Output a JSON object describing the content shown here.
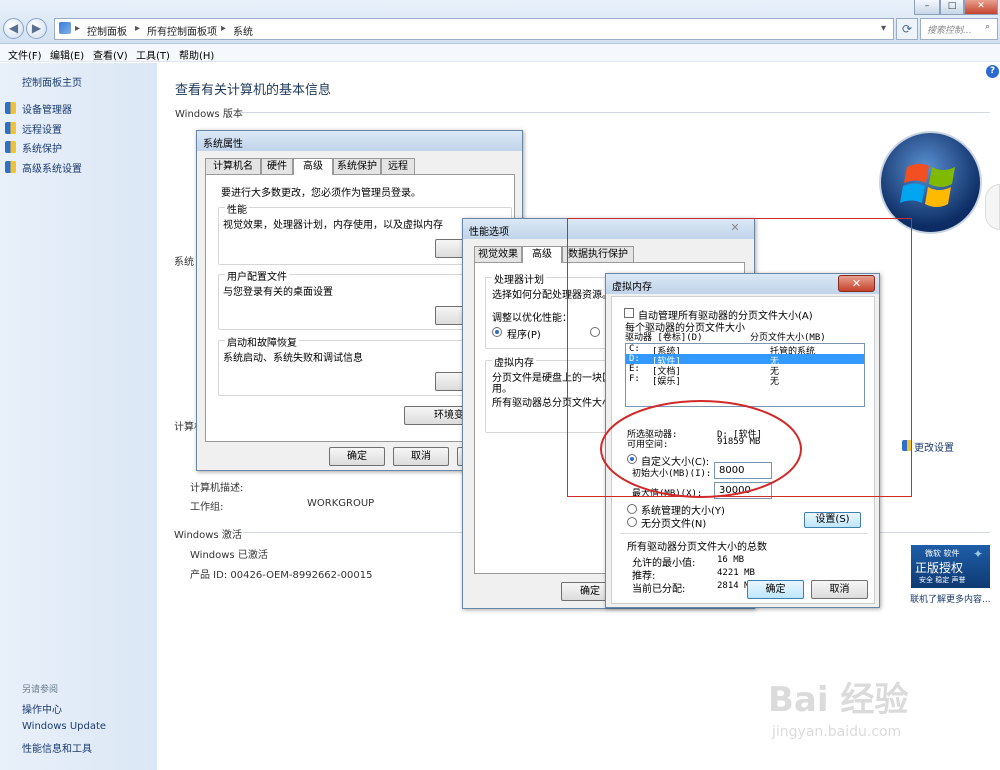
{
  "breadcrumb": [
    "控制面板",
    "所有控制面板项",
    "系统"
  ],
  "search_placeholder": "搜索控制...",
  "window_controls": {
    "minimize": "–",
    "maximize": "□",
    "close": "✕"
  },
  "menu": [
    "文件(F)",
    "编辑(E)",
    "查看(V)",
    "工具(T)",
    "帮助(H)"
  ],
  "left_pane": {
    "home": "控制面板主页",
    "tasks": [
      "设备管理器",
      "远程设置",
      "系统保护",
      "高级系统设置"
    ],
    "see_also_header": "另请参阅",
    "see_also": [
      "操作中心",
      "Windows Update",
      "性能信息和工具"
    ]
  },
  "main": {
    "title": "查看有关计算机的基本信息",
    "windows_edition": "Windows 版本",
    "system": "系统",
    "computer_section": "计算机",
    "computer_description_label": "计算机描述:",
    "workgroup_label": "工作组:",
    "workgroup_value": "WORKGROUP",
    "change_settings": "更改设置",
    "activation_header": "Windows 激活",
    "activation_status": "Windows 已激活",
    "product_id": "产品 ID: 00426-OEM-8992662-00015",
    "genuine": {
      "line1": "微软 软件",
      "line2": "正版授权",
      "line3": "安全 稳定 声誉",
      "link": "联机了解更多内容..."
    }
  },
  "sysprops": {
    "title": "系统属性",
    "tabs": [
      "计算机名",
      "硬件",
      "高级",
      "系统保护",
      "远程"
    ],
    "admin_note": "要进行大多数更改，您必须作为管理员登录。",
    "perf_label": "性能",
    "perf_desc": "视觉效果，处理器计划，内存使用，以及虚拟内存",
    "profile_label": "用户配置文件",
    "profile_desc": "与您登录有关的桌面设置",
    "startup_label": "启动和故障恢复",
    "startup_desc": "系统启动、系统失败和调试信息",
    "settings_btn": "设置",
    "env_btn": "环境变量",
    "ok": "确定",
    "cancel": "取消"
  },
  "perfopts": {
    "title": "性能选项",
    "tabs": [
      "视觉效果",
      "高级",
      "数据执行保护"
    ],
    "cpu_label": "处理器计划",
    "cpu_desc": "选择如何分配处理器资源。",
    "adjust_label": "调整以优化性能：",
    "programs": "程序(P)",
    "vm_label": "虚拟内存",
    "vm_desc_line1": "分页文件是硬盘上的一块区",
    "vm_desc_line2": "用。",
    "vm_total": "所有驱动器总分页文件大小",
    "ok": "确定"
  },
  "vmem": {
    "title": "虚拟内存",
    "auto_manage": "自动管理所有驱动器的分页文件大小(A)",
    "per_drive_header": "每个驱动器的分页文件大小",
    "col_drive": "驱动器 [卷标](D)",
    "col_size": "分页文件大小(MB)",
    "drives": [
      {
        "drive": "C:",
        "label": "[系统]",
        "size": "托管的系统"
      },
      {
        "drive": "D:",
        "label": "[软件]",
        "size": "无"
      },
      {
        "drive": "E:",
        "label": "[文档]",
        "size": "无"
      },
      {
        "drive": "F:",
        "label": "[娱乐]",
        "size": "无"
      }
    ],
    "selected_drive_label": "所选驱动器:",
    "selected_drive_value": "D:  [软件]",
    "free_space_label": "可用空间:",
    "free_space_value": "91859 MB",
    "custom_size": "自定义大小(C):",
    "initial_label": "初始大小(MB)(I):",
    "initial_value": "8000",
    "max_label": "最大值(MB)(X):",
    "max_value": "30000",
    "system_managed": "系统管理的大小(Y)",
    "no_paging": "无分页文件(N)",
    "set_btn": "设置(S)",
    "total_header": "所有驱动器分页文件大小的总数",
    "min_allowed_label": "允许的最小值:",
    "min_allowed_value": "16 MB",
    "recommended_label": "推荐:",
    "recommended_value": "4221 MB",
    "allocated_label": "当前已分配:",
    "allocated_value": "2814 MB",
    "ok": "确定",
    "cancel": "取消"
  },
  "watermark": {
    "brand": "Bai 经验",
    "url": "jingyan.baidu.com"
  },
  "colors": {
    "highlight": "#3399ff",
    "annotation_red": "#d02a2a",
    "link": "#1b3b6e"
  }
}
